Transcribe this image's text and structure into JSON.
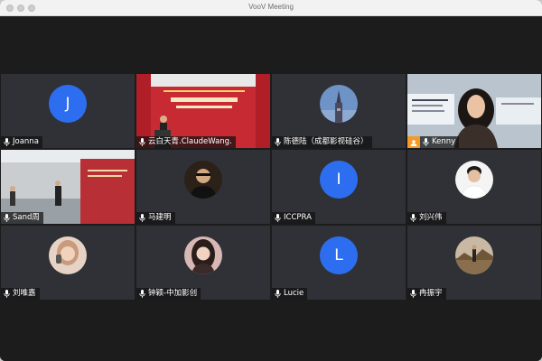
{
  "window": {
    "title": "VooV Meeting"
  },
  "participants": [
    {
      "name": "Joanna",
      "letter": "J",
      "kind": "letter"
    },
    {
      "name": "云白天青.ClaudeWang.",
      "kind": "video-hall"
    },
    {
      "name": "陈德陆（成都影视硅谷）",
      "kind": "photo-tower"
    },
    {
      "name": "Kenny",
      "kind": "video-girl"
    },
    {
      "name": "Sand周",
      "kind": "video-room",
      "active": true
    },
    {
      "name": "马建明",
      "kind": "photo-man"
    },
    {
      "name": "ICCPRA",
      "letter": "I",
      "kind": "letter"
    },
    {
      "name": "刘兴伟",
      "kind": "photo-boy"
    },
    {
      "name": "刘唯嘉",
      "kind": "photo-woman"
    },
    {
      "name": "钟颖-中加影创",
      "kind": "photo-girl"
    },
    {
      "name": "Lucie",
      "letter": "L",
      "kind": "letter"
    },
    {
      "name": "冉振宇",
      "kind": "photo-outdoor"
    }
  ],
  "colors": {
    "accent": "#2d6ef0",
    "active_border": "#52c35a",
    "tile_bg": "#2f3136"
  },
  "icons": {
    "mic": "microphone-icon",
    "camera": "camera-icon"
  }
}
